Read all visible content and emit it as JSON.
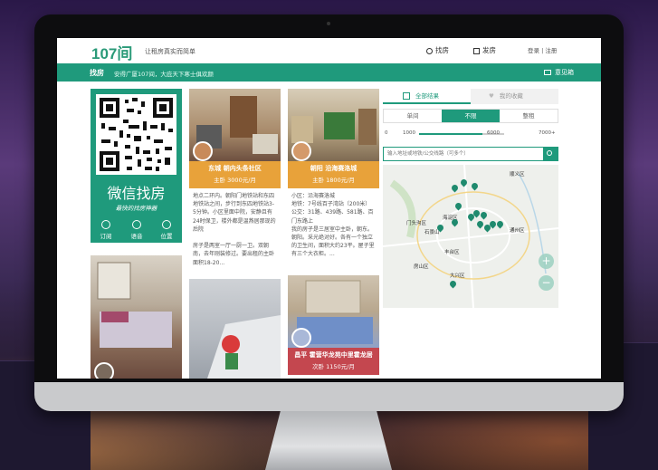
{
  "site": {
    "logo": "107间",
    "slogan": "让租房真实而简单"
  },
  "nav": {
    "find": "找房",
    "post": "发房",
    "login": "登录 | 注册"
  },
  "banner": {
    "title": "找房",
    "subtitle": "安得广厦107间，大庇天下寒士俱欢颜",
    "feedback": "意见箱"
  },
  "qr_card": {
    "title": "微信找房",
    "subtitle": "最快的找房神器",
    "icons": [
      "订阅",
      "语音",
      "位置"
    ]
  },
  "cards": [
    {
      "title": "东城 朝内头条社区",
      "price": "主卧 3000元/月",
      "desc": "地点二环内。朝阳门地铁站和东四地铁站之间，步行到东四地铁站3-5分钟。小区里面中院，安静且有24时保卫，楼外都是温燕居那现的后院\n\n房子是两室一厅一厨一卫。双朝南，去年刚装修过。要出租的主卧面积18-20..."
    },
    {
      "title": "朝阳 沿海赛洛城",
      "price": "主卧 1800元/月",
      "desc": "小区：沿海赛洛城\n地铁：7号线百子湾站（200米）\n公交：31路、439路、581路、百门东路上\n我的房子是三居室中主卧，朝东。朝阳。采光绝对好。各有一个独立的卫生间，面积大约23平。屋子里有三个大衣柜。..."
    },
    {
      "title": "昌平 霍营华龙苑中里霍龙居",
      "price": "次卧 1150元/月"
    }
  ],
  "panel": {
    "tab_all": "全部结果",
    "tab_fav": "我的收藏",
    "room_types": [
      "单间",
      "不限",
      "整租"
    ],
    "price_min_label": "0",
    "price_low": "1000",
    "price_high": "6000",
    "price_max_label": "7000+",
    "search_placeholder": "输入地址或地铁/公交线路（可多个）",
    "map_labels": [
      "顺义区",
      "海淀区",
      "门头沟区",
      "石景山",
      "通州区",
      "丰台区",
      "房山区",
      "大兴区"
    ]
  },
  "colors": {
    "brand": "#1f9a7c",
    "card_orange": "#e8a23a",
    "card_red": "#c4474f"
  }
}
